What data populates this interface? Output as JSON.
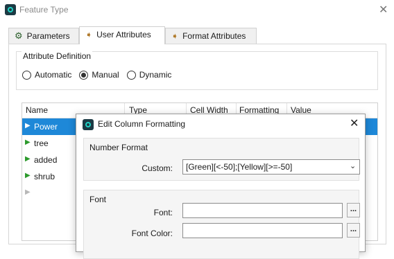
{
  "window": {
    "title": "Feature Type",
    "close_glyph": "✕"
  },
  "tabs": [
    {
      "label": "Parameters",
      "icon": "gear-icon"
    },
    {
      "label": "User Attributes",
      "icon": "arrow-right-icon"
    },
    {
      "label": "Format Attributes",
      "icon": "arrow-right-icon"
    }
  ],
  "attribute_definition": {
    "title": "Attribute Definition",
    "options": [
      "Automatic",
      "Manual",
      "Dynamic"
    ],
    "selected": "Manual"
  },
  "table": {
    "columns": [
      "Name",
      "Type",
      "Cell Width",
      "Formatting",
      "Value"
    ],
    "rows": [
      {
        "name": "Power",
        "selected": true
      },
      {
        "name": "tree",
        "selected": false
      },
      {
        "name": "added",
        "selected": false
      },
      {
        "name": "shrub",
        "selected": false
      },
      {
        "name": "",
        "selected": false
      }
    ],
    "row_arrow": "▶",
    "selected_color": "#1e88d8"
  },
  "dialog": {
    "title": "Edit Column Formatting",
    "close_glyph": "✕",
    "number_format": {
      "title": "Number Format",
      "custom_label": "Custom:",
      "custom_value": "[Green][<-50];[Yellow][>=-50]",
      "chevron": "⌄"
    },
    "font": {
      "title": "Font",
      "font_label": "Font:",
      "font_value": "",
      "font_color_label": "Font Color:",
      "font_color_value": "",
      "ellipsis": "..."
    }
  }
}
